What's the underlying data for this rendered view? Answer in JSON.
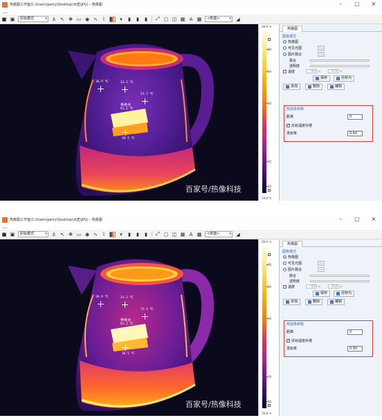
{
  "title": "热像图工作室(C:\\Users\\perry\\Desktop\\水壶\\JPG) - 热像图",
  "window_controls": {
    "minimize": "–",
    "maximize": "□",
    "close": "×"
  },
  "toolbar": {
    "mode_select": "原始模式",
    "label_select": "<新建>"
  },
  "side_panel": {
    "tab": "热像图",
    "group": "图像模式",
    "radio_thermal": "热像图",
    "radio_visible": "可见光图",
    "radio_fusion": "图片融合",
    "slider_blend": "融合",
    "slider_transparency": "透明度",
    "checkbox_range": "温度",
    "range_min": "0.0",
    "range_max": "70.0",
    "range_unit": "℃",
    "btn_save": "保存",
    "btn_saveas": "另存为",
    "btn_add": "添加",
    "btn_delete": "删除",
    "btn_edit": "编辑",
    "emit_group": "热成像参数",
    "emit_distance_label": "距离",
    "emit_distance_value": "0",
    "emit_checkbox": "反射温度补偿",
    "emit_label": "发射率"
  },
  "palette": {
    "top": "39.9 ℃",
    "bottom": "19.8 ℃",
    "ticks": [
      "80",
      "60",
      "40",
      "20",
      "30"
    ]
  },
  "watermark": "百家号/热像科技",
  "reference_label": "参考点",
  "screenshots": [
    {
      "temps": {
        "left": "36.9 ℃",
        "center": "31.2 ℃",
        "right": "31.7 ℃",
        "reference": "61.2 ℃",
        "lower": "39.5 ℃"
      },
      "emissivity": "0.60"
    },
    {
      "temps": {
        "left": "36.9 ℃",
        "center": "31.2 ℃",
        "right": "72.5 ℃",
        "reference": "61.2 ℃",
        "lower": "36.5 ℃"
      },
      "emissivity": "0.90"
    }
  ],
  "colors": {
    "accent": "#3d6db5",
    "highlight_border": "#e23a3a"
  }
}
